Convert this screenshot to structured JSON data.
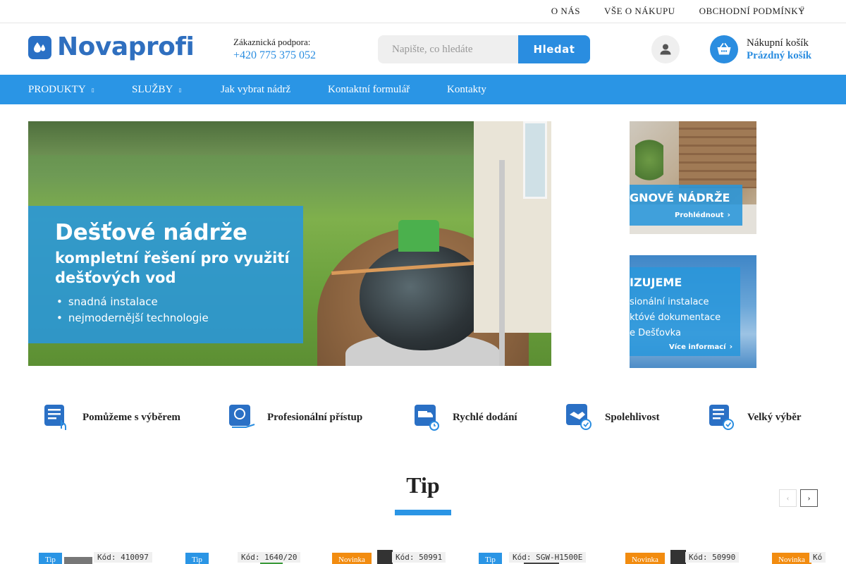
{
  "topbar": {
    "links": [
      "O NÁS",
      "VŠE O NÁKUPU",
      "OBCHODNÍ PODMÍNKY"
    ]
  },
  "header": {
    "logo_text": "Novaprofi",
    "support_label": "Zákaznická podpora:",
    "support_phone": "+420 775 375 052",
    "search_placeholder": "Napište, co hledáte",
    "search_button": "Hledat",
    "cart_label": "Nákupní košík",
    "cart_status": "Prázdný košík"
  },
  "nav": {
    "items": [
      {
        "label": "PRODUKTY",
        "has_dropdown": true
      },
      {
        "label": "SLUŽBY",
        "has_dropdown": true
      },
      {
        "label": "Jak vybrat nádrž",
        "has_dropdown": false
      },
      {
        "label": "Kontaktní formulář",
        "has_dropdown": false
      },
      {
        "label": "Kontakty",
        "has_dropdown": false
      }
    ]
  },
  "hero": {
    "title": "Dešťové nádrže",
    "subtitle_line1": "kompletní řešení pro využití",
    "subtitle_line2": "dešťových vod",
    "bullets": [
      "snadná instalace",
      "nejmodernější technologie"
    ]
  },
  "side_banners": [
    {
      "title": "GNOVÉ NÁDRŽE",
      "cta": "Prohlédnout"
    },
    {
      "title": "IZUJEME",
      "lines": [
        "sionální instalace",
        "któvé dokumentace",
        "e Dešťovka"
      ],
      "cta": "Více informací"
    }
  ],
  "features": [
    {
      "label": "Pomůžeme s výběrem",
      "icon": "list-hand-icon"
    },
    {
      "label": "Profesionální přístup",
      "icon": "award-hand-icon"
    },
    {
      "label": "Rychlé dodání",
      "icon": "delivery-truck-icon"
    },
    {
      "label": "Spolehlivost",
      "icon": "handshake-icon"
    },
    {
      "label": "Velký výběr",
      "icon": "checklist-icon"
    }
  ],
  "tip_section": {
    "title": "Tip"
  },
  "products": [
    {
      "badge": "Tip",
      "badge_type": "tip",
      "code": "Kód: 410097"
    },
    {
      "badge": "Tip",
      "badge_type": "tip",
      "code": "Kód: 1640/20"
    },
    {
      "badge": "Novinka",
      "badge_type": "new",
      "code": "Kód: 50991"
    },
    {
      "badge": "Tip",
      "badge_type": "tip",
      "code": "Kód: SGW-H1500E"
    },
    {
      "badge": "Novinka",
      "badge_type": "new",
      "code": "Kód: 50990"
    },
    {
      "badge": "Novinka",
      "badge_type": "new",
      "code": "Kó"
    }
  ],
  "colors": {
    "primary": "#2a95e5",
    "logo": "#2f6fbf",
    "badge_new": "#f28c10"
  }
}
